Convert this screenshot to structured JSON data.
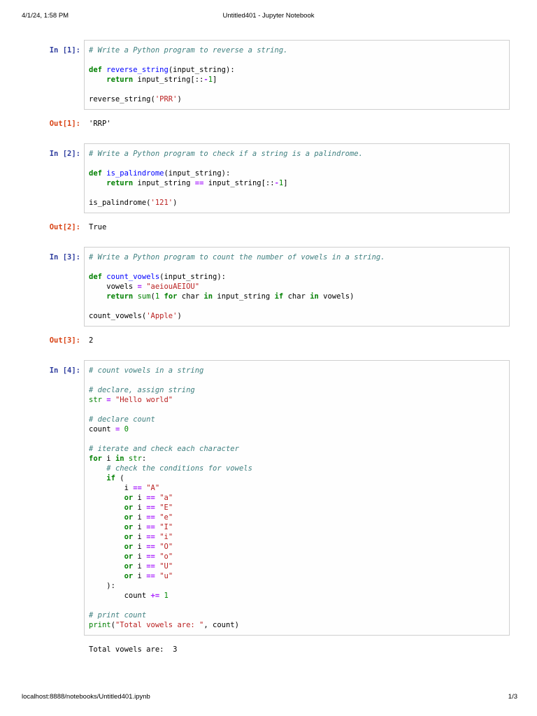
{
  "page": {
    "header_left": "4/1/24, 1:58 PM",
    "header_title": "Untitled401 - Jupyter Notebook",
    "footer_left": "localhost:8888/notebooks/Untitled401.ipynb",
    "footer_right": "1/3"
  },
  "colors": {
    "prompt_in": "#303F9F",
    "prompt_out": "#D84315",
    "cell_border": "#cfcfcf",
    "comment": "#408080",
    "keyword": "#008000",
    "builtin": "#008000",
    "string": "#BA2121",
    "number": "#008800",
    "operator": "#AA22FF",
    "def_name": "#0000FF"
  },
  "cells": [
    {
      "prompt_in": "In [1]:",
      "prompt_out": "Out[1]:",
      "output": "'RRP'",
      "code": [
        [
          [
            "c",
            "# Write a Python program to reverse a string."
          ]
        ],
        [],
        [
          [
            "k",
            "def"
          ],
          [
            "p",
            " "
          ],
          [
            "f",
            "reverse_string"
          ],
          [
            "p",
            "(input_string):"
          ]
        ],
        [
          [
            "p",
            "    "
          ],
          [
            "k",
            "return"
          ],
          [
            "p",
            " input_string[::"
          ],
          [
            "o",
            "-"
          ],
          [
            "n",
            "1"
          ],
          [
            "p",
            "]"
          ]
        ],
        [],
        [
          [
            "p",
            "reverse_string("
          ],
          [
            "s",
            "'PRR'"
          ],
          [
            "p",
            ")"
          ]
        ]
      ]
    },
    {
      "prompt_in": "In [2]:",
      "prompt_out": "Out[2]:",
      "output": "True",
      "code": [
        [
          [
            "c",
            "# Write a Python program to check if a string is a palindrome."
          ]
        ],
        [],
        [
          [
            "k",
            "def"
          ],
          [
            "p",
            " "
          ],
          [
            "f",
            "is_palindrome"
          ],
          [
            "p",
            "(input_string):"
          ]
        ],
        [
          [
            "p",
            "    "
          ],
          [
            "k",
            "return"
          ],
          [
            "p",
            " input_string "
          ],
          [
            "o",
            "=="
          ],
          [
            "p",
            " input_string[::"
          ],
          [
            "o",
            "-"
          ],
          [
            "n",
            "1"
          ],
          [
            "p",
            "]"
          ]
        ],
        [],
        [
          [
            "p",
            "is_palindrome("
          ],
          [
            "s",
            "'121'"
          ],
          [
            "p",
            ")"
          ]
        ]
      ]
    },
    {
      "prompt_in": "In [3]:",
      "prompt_out": "Out[3]:",
      "output": "2",
      "code": [
        [
          [
            "c",
            "# Write a Python program to count the number of vowels in a string."
          ]
        ],
        [],
        [
          [
            "k",
            "def"
          ],
          [
            "p",
            " "
          ],
          [
            "f",
            "count_vowels"
          ],
          [
            "p",
            "(input_string):"
          ]
        ],
        [
          [
            "p",
            "    vowels "
          ],
          [
            "o",
            "="
          ],
          [
            "p",
            " "
          ],
          [
            "s",
            "\"aeiouAEIOU\""
          ]
        ],
        [
          [
            "p",
            "    "
          ],
          [
            "k",
            "return"
          ],
          [
            "p",
            " "
          ],
          [
            "b",
            "sum"
          ],
          [
            "p",
            "("
          ],
          [
            "n",
            "1"
          ],
          [
            "p",
            " "
          ],
          [
            "k",
            "for"
          ],
          [
            "p",
            " char "
          ],
          [
            "k",
            "in"
          ],
          [
            "p",
            " input_string "
          ],
          [
            "k",
            "if"
          ],
          [
            "p",
            " char "
          ],
          [
            "k",
            "in"
          ],
          [
            "p",
            " vowels)"
          ]
        ],
        [],
        [
          [
            "p",
            "count_vowels("
          ],
          [
            "s",
            "'Apple'"
          ],
          [
            "p",
            ")"
          ]
        ]
      ]
    },
    {
      "prompt_in": "In [4]:",
      "prompt_out": null,
      "output": "Total vowels are:  3",
      "code": [
        [
          [
            "c",
            "# count vowels in a string"
          ]
        ],
        [],
        [
          [
            "c",
            "# declare, assign string"
          ]
        ],
        [
          [
            "b",
            "str"
          ],
          [
            "p",
            " "
          ],
          [
            "o",
            "="
          ],
          [
            "p",
            " "
          ],
          [
            "s",
            "\"Hello world\""
          ]
        ],
        [],
        [
          [
            "c",
            "# declare count"
          ]
        ],
        [
          [
            "p",
            "count "
          ],
          [
            "o",
            "="
          ],
          [
            "p",
            " "
          ],
          [
            "n",
            "0"
          ]
        ],
        [],
        [
          [
            "c",
            "# iterate and check each character"
          ]
        ],
        [
          [
            "k",
            "for"
          ],
          [
            "p",
            " i "
          ],
          [
            "k",
            "in"
          ],
          [
            "p",
            " "
          ],
          [
            "b",
            "str"
          ],
          [
            "p",
            ":"
          ]
        ],
        [
          [
            "p",
            "    "
          ],
          [
            "c",
            "# check the conditions for vowels"
          ]
        ],
        [
          [
            "p",
            "    "
          ],
          [
            "k",
            "if"
          ],
          [
            "p",
            " ("
          ]
        ],
        [
          [
            "p",
            "        i "
          ],
          [
            "o",
            "=="
          ],
          [
            "p",
            " "
          ],
          [
            "s",
            "\"A\""
          ]
        ],
        [
          [
            "p",
            "        "
          ],
          [
            "k",
            "or"
          ],
          [
            "p",
            " i "
          ],
          [
            "o",
            "=="
          ],
          [
            "p",
            " "
          ],
          [
            "s",
            "\"a\""
          ]
        ],
        [
          [
            "p",
            "        "
          ],
          [
            "k",
            "or"
          ],
          [
            "p",
            " i "
          ],
          [
            "o",
            "=="
          ],
          [
            "p",
            " "
          ],
          [
            "s",
            "\"E\""
          ]
        ],
        [
          [
            "p",
            "        "
          ],
          [
            "k",
            "or"
          ],
          [
            "p",
            " i "
          ],
          [
            "o",
            "=="
          ],
          [
            "p",
            " "
          ],
          [
            "s",
            "\"e\""
          ]
        ],
        [
          [
            "p",
            "        "
          ],
          [
            "k",
            "or"
          ],
          [
            "p",
            " i "
          ],
          [
            "o",
            "=="
          ],
          [
            "p",
            " "
          ],
          [
            "s",
            "\"I\""
          ]
        ],
        [
          [
            "p",
            "        "
          ],
          [
            "k",
            "or"
          ],
          [
            "p",
            " i "
          ],
          [
            "o",
            "=="
          ],
          [
            "p",
            " "
          ],
          [
            "s",
            "\"i\""
          ]
        ],
        [
          [
            "p",
            "        "
          ],
          [
            "k",
            "or"
          ],
          [
            "p",
            " i "
          ],
          [
            "o",
            "=="
          ],
          [
            "p",
            " "
          ],
          [
            "s",
            "\"O\""
          ]
        ],
        [
          [
            "p",
            "        "
          ],
          [
            "k",
            "or"
          ],
          [
            "p",
            " i "
          ],
          [
            "o",
            "=="
          ],
          [
            "p",
            " "
          ],
          [
            "s",
            "\"o\""
          ]
        ],
        [
          [
            "p",
            "        "
          ],
          [
            "k",
            "or"
          ],
          [
            "p",
            " i "
          ],
          [
            "o",
            "=="
          ],
          [
            "p",
            " "
          ],
          [
            "s",
            "\"U\""
          ]
        ],
        [
          [
            "p",
            "        "
          ],
          [
            "k",
            "or"
          ],
          [
            "p",
            " i "
          ],
          [
            "o",
            "=="
          ],
          [
            "p",
            " "
          ],
          [
            "s",
            "\"u\""
          ]
        ],
        [
          [
            "p",
            "    ):"
          ]
        ],
        [
          [
            "p",
            "        count "
          ],
          [
            "o",
            "+="
          ],
          [
            "p",
            " "
          ],
          [
            "n",
            "1"
          ]
        ],
        [],
        [
          [
            "c",
            "# print count"
          ]
        ],
        [
          [
            "b",
            "print"
          ],
          [
            "p",
            "("
          ],
          [
            "s",
            "\"Total vowels are: \""
          ],
          [
            "p",
            ", count)"
          ]
        ]
      ]
    }
  ]
}
